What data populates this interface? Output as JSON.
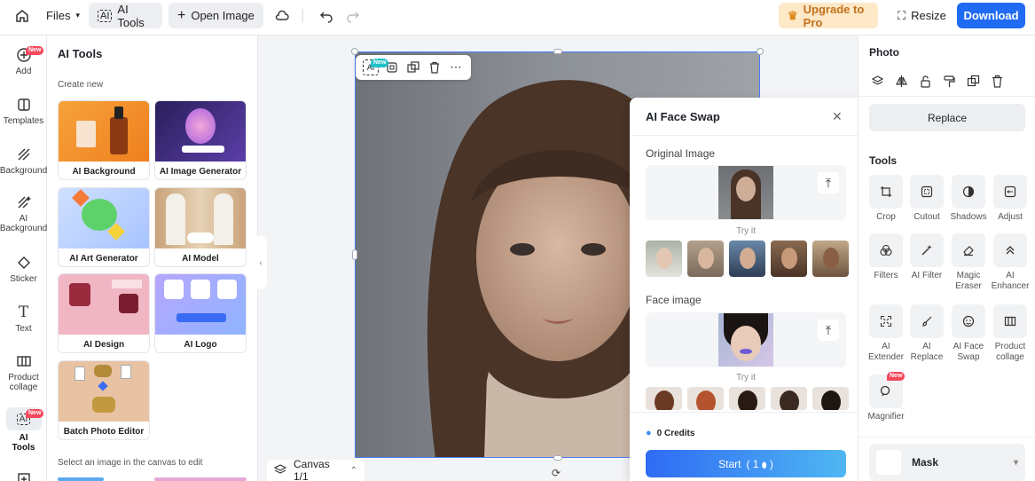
{
  "topbar": {
    "files_label": "Files",
    "ai_tools_label": "AI Tools",
    "open_image_label": "Open Image",
    "upgrade_label": "Upgrade to Pro",
    "resize_label": "Resize",
    "download_label": "Download"
  },
  "rail": {
    "items": [
      {
        "label": "Add",
        "badge": "New"
      },
      {
        "label": "Templates"
      },
      {
        "label": "Background"
      },
      {
        "label": "AI Background"
      },
      {
        "label": "Sticker"
      },
      {
        "label": "Text"
      },
      {
        "label": "Product collage"
      },
      {
        "label": "AI Tools",
        "badge": "New"
      }
    ]
  },
  "panel": {
    "title": "AI Tools",
    "subtitle": "Create new",
    "cards": [
      {
        "label": "AI Background"
      },
      {
        "label": "AI Image Generator"
      },
      {
        "label": "AI Art Generator"
      },
      {
        "label": "AI Model"
      },
      {
        "label": "AI Design"
      },
      {
        "label": "AI Logo"
      },
      {
        "label": "Batch Photo Editor"
      }
    ],
    "footer": "Select an image in the canvas to edit"
  },
  "canvas": {
    "mini_badge": "New",
    "footer_label": "Canvas 1/1"
  },
  "dialog": {
    "title": "AI Face Swap",
    "original_label": "Original Image",
    "tryit_label": "Try it",
    "face_label": "Face image",
    "credits_label": "0 Credits",
    "start_label": "Start",
    "start_cost": "1"
  },
  "rpanel": {
    "title": "Photo",
    "replace_label": "Replace",
    "tools_title": "Tools",
    "tools": [
      {
        "label": "Crop"
      },
      {
        "label": "Cutout"
      },
      {
        "label": "Shadows"
      },
      {
        "label": "Adjust"
      },
      {
        "label": "Filters"
      },
      {
        "label": "AI Filter"
      },
      {
        "label": "Magic Eraser"
      },
      {
        "label": "AI Enhancer"
      },
      {
        "label": "AI Extender"
      },
      {
        "label": "AI Replace"
      },
      {
        "label": "AI Face Swap"
      },
      {
        "label": "Product collage"
      },
      {
        "label": "Magnifier",
        "badge": "New"
      }
    ],
    "mask_label": "Mask"
  },
  "colors": {
    "accent": "#1f6bf4",
    "upgrade_bg": "#fde8c8",
    "upgrade_text": "#c4711c",
    "badge": "#f5475b"
  }
}
